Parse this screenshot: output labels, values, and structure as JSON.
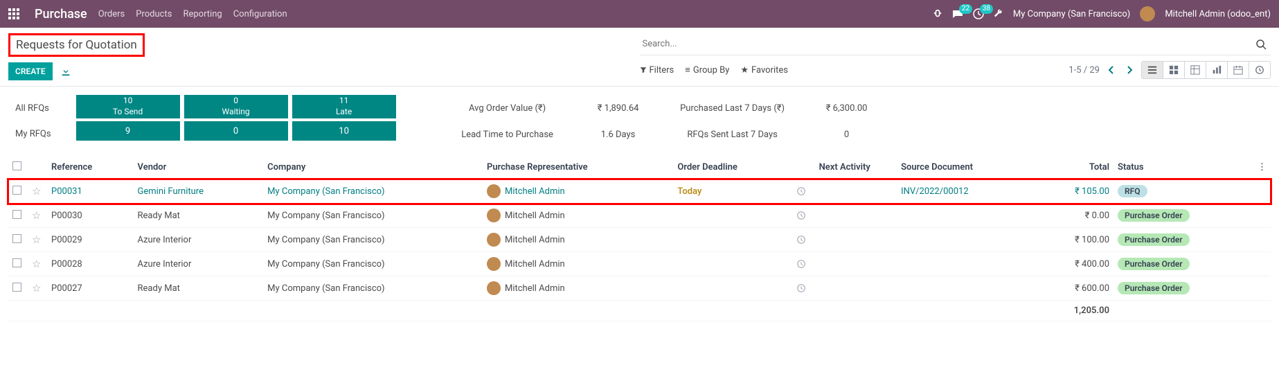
{
  "nav": {
    "app": "Purchase",
    "links": [
      "Orders",
      "Products",
      "Reporting",
      "Configuration"
    ],
    "msg_count": "22",
    "activity_count": "38",
    "company": "My Company (San Francisco)",
    "user": "Mitchell Admin (odoo_ent)"
  },
  "page": {
    "title": "Requests for Quotation",
    "create": "CREATE",
    "search_placeholder": "Search..."
  },
  "controls": {
    "filters": "Filters",
    "group_by": "Group By",
    "favorites": "Favorites",
    "pager": "1-5 / 29"
  },
  "dashboard": {
    "filter_all": "All RFQs",
    "filter_my": "My RFQs",
    "cards": [
      {
        "top_number": "10",
        "top_label": "To Send",
        "bottom_number": "9"
      },
      {
        "top_number": "0",
        "top_label": "Waiting",
        "bottom_number": "0"
      },
      {
        "top_number": "11",
        "top_label": "Late",
        "bottom_number": "10"
      }
    ],
    "stats": {
      "avg_label": "Avg Order Value (₹)",
      "avg_value": "₹ 1,890.64",
      "lead_label": "Lead Time to Purchase",
      "lead_value": "1.6  Days",
      "purchased_label": "Purchased Last 7 Days (₹)",
      "purchased_value": "₹ 6,300.00",
      "sent_label": "RFQs Sent Last 7 Days",
      "sent_value": "0"
    }
  },
  "columns": {
    "reference": "Reference",
    "vendor": "Vendor",
    "company": "Company",
    "rep": "Purchase Representative",
    "deadline": "Order Deadline",
    "activity": "Next Activity",
    "source": "Source Document",
    "total": "Total",
    "status": "Status"
  },
  "rows": [
    {
      "ref": "P00031",
      "vendor": "Gemini Furniture",
      "company": "My Company (San Francisco)",
      "rep": "Mitchell Admin",
      "deadline": "Today",
      "source": "INV/2022/00012",
      "total": "₹ 105.00",
      "status": "RFQ",
      "highlight": true
    },
    {
      "ref": "P00030",
      "vendor": "Ready Mat",
      "company": "My Company (San Francisco)",
      "rep": "Mitchell Admin",
      "deadline": "",
      "source": "",
      "total": "₹ 0.00",
      "status": "Purchase Order"
    },
    {
      "ref": "P00029",
      "vendor": "Azure Interior",
      "company": "My Company (San Francisco)",
      "rep": "Mitchell Admin",
      "deadline": "",
      "source": "",
      "total": "₹ 100.00",
      "status": "Purchase Order"
    },
    {
      "ref": "P00028",
      "vendor": "Azure Interior",
      "company": "My Company (San Francisco)",
      "rep": "Mitchell Admin",
      "deadline": "",
      "source": "",
      "total": "₹ 400.00",
      "status": "Purchase Order"
    },
    {
      "ref": "P00027",
      "vendor": "Ready Mat",
      "company": "My Company (San Francisco)",
      "rep": "Mitchell Admin",
      "deadline": "",
      "source": "",
      "total": "₹ 600.00",
      "status": "Purchase Order"
    }
  ],
  "footer_total": "1,205.00"
}
